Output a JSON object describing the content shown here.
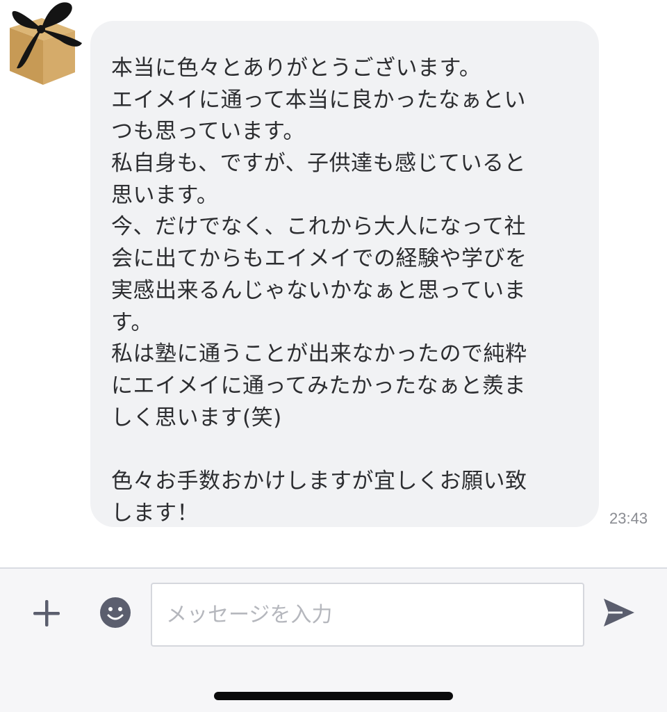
{
  "chat": {
    "message": {
      "lines": [
        "本当に色々とありがとうございます。",
        "エイメイに通って本当に良かったなぁとい",
        "つも思っています。",
        "私自身も、ですが、子供達も感じていると",
        "思います。",
        "今、だけでなく、これから大人になって社",
        "会に出てからもエイメイでの経験や学びを",
        "実感出来るんじゃないかなぁと思っていま",
        "す。",
        "私は塾に通うことが出来なかったので純粋",
        "にエイメイに通ってみたかったなぁと羨ま",
        "しく思います(笑)",
        "",
        "色々お手数おかけしますが宜しくお願い致",
        "します！"
      ],
      "time": "23:43"
    },
    "avatar_icon": "gift-box-icon"
  },
  "input_bar": {
    "placeholder": "メッセージを入力",
    "plus_icon": "plus-icon",
    "emoji_icon": "smiley-icon",
    "send_icon": "send-icon"
  },
  "colors": {
    "bubble": "#f1f2f4",
    "text": "#2c2d30",
    "icon": "#5b5e6e",
    "input_bar_bg": "#f6f6f8"
  }
}
